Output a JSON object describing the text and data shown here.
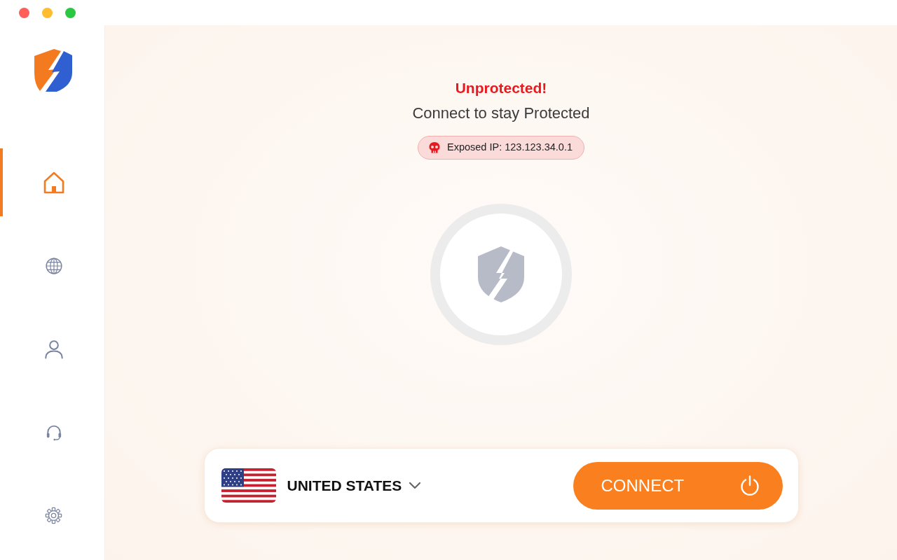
{
  "sidebar": {
    "items": [
      {
        "kind": "home",
        "selected": true
      },
      {
        "kind": "globe",
        "selected": false
      },
      {
        "kind": "account",
        "selected": false
      },
      {
        "kind": "support",
        "selected": false
      },
      {
        "kind": "settings",
        "selected": false
      }
    ]
  },
  "status": {
    "title": "Unprotected!",
    "subtitle": "Connect to stay Protected",
    "exposed_ip": "Exposed IP: 123.123.34.0.1"
  },
  "connection": {
    "country": "UNITED STATES",
    "button": "CONNECT"
  }
}
